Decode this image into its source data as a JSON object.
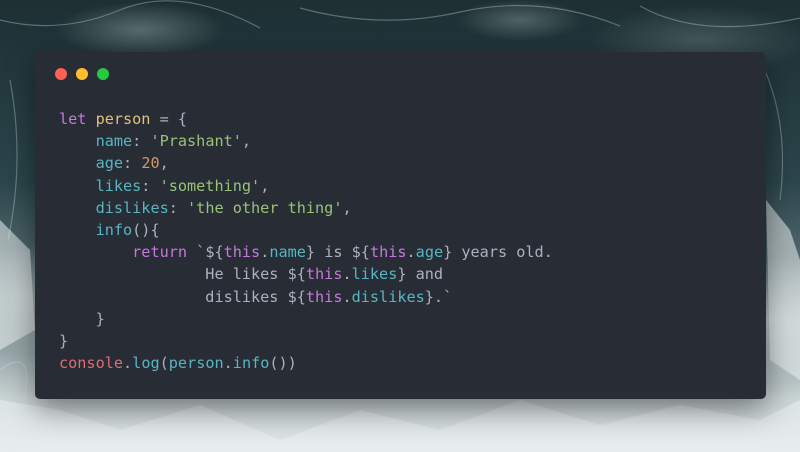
{
  "window": {
    "controls": [
      {
        "name": "close",
        "color": "#ff5f56"
      },
      {
        "name": "minimize",
        "color": "#ffbd2e"
      },
      {
        "name": "maximize",
        "color": "#27c93f"
      }
    ]
  },
  "theme": {
    "background": "#282c34",
    "keyword": "#c678dd",
    "variable": "#e5c07b",
    "property": "#56b6c2",
    "string": "#98c379",
    "number": "#d19a66",
    "console": "#e06c75",
    "plain": "#abb2bf"
  },
  "code": {
    "lines": [
      [
        {
          "t": "keyword",
          "v": "let"
        },
        {
          "t": "plain",
          "v": " "
        },
        {
          "t": "var",
          "v": "person"
        },
        {
          "t": "plain",
          "v": " = {"
        }
      ],
      [
        {
          "t": "plain",
          "v": "    "
        },
        {
          "t": "prop",
          "v": "name"
        },
        {
          "t": "plain",
          "v": ": "
        },
        {
          "t": "string",
          "v": "'Prashant'"
        },
        {
          "t": "plain",
          "v": ","
        }
      ],
      [
        {
          "t": "plain",
          "v": "    "
        },
        {
          "t": "prop",
          "v": "age"
        },
        {
          "t": "plain",
          "v": ": "
        },
        {
          "t": "number",
          "v": "20"
        },
        {
          "t": "plain",
          "v": ","
        }
      ],
      [
        {
          "t": "plain",
          "v": "    "
        },
        {
          "t": "prop",
          "v": "likes"
        },
        {
          "t": "plain",
          "v": ": "
        },
        {
          "t": "string",
          "v": "'something'"
        },
        {
          "t": "plain",
          "v": ","
        }
      ],
      [
        {
          "t": "plain",
          "v": "    "
        },
        {
          "t": "prop",
          "v": "dislikes"
        },
        {
          "t": "plain",
          "v": ": "
        },
        {
          "t": "string",
          "v": "'the other thing'"
        },
        {
          "t": "plain",
          "v": ","
        }
      ],
      [
        {
          "t": "plain",
          "v": "    "
        },
        {
          "t": "prop",
          "v": "info"
        },
        {
          "t": "plain",
          "v": "(){"
        }
      ],
      [
        {
          "t": "plain",
          "v": "        "
        },
        {
          "t": "keyword",
          "v": "return"
        },
        {
          "t": "plain",
          "v": " `${"
        },
        {
          "t": "keyword",
          "v": "this"
        },
        {
          "t": "plain",
          "v": "."
        },
        {
          "t": "prop",
          "v": "name"
        },
        {
          "t": "plain",
          "v": "} is ${"
        },
        {
          "t": "keyword",
          "v": "this"
        },
        {
          "t": "plain",
          "v": "."
        },
        {
          "t": "prop",
          "v": "age"
        },
        {
          "t": "plain",
          "v": "} years old."
        }
      ],
      [
        {
          "t": "plain",
          "v": "                He likes ${"
        },
        {
          "t": "keyword",
          "v": "this"
        },
        {
          "t": "plain",
          "v": "."
        },
        {
          "t": "prop",
          "v": "likes"
        },
        {
          "t": "plain",
          "v": "} and"
        }
      ],
      [
        {
          "t": "plain",
          "v": "                dislikes ${"
        },
        {
          "t": "keyword",
          "v": "this"
        },
        {
          "t": "plain",
          "v": "."
        },
        {
          "t": "prop",
          "v": "dislikes"
        },
        {
          "t": "plain",
          "v": "}.`"
        }
      ],
      [
        {
          "t": "plain",
          "v": "    }"
        }
      ],
      [
        {
          "t": "plain",
          "v": "}"
        }
      ],
      [
        {
          "t": "console",
          "v": "console"
        },
        {
          "t": "plain",
          "v": "."
        },
        {
          "t": "prop",
          "v": "log"
        },
        {
          "t": "plain",
          "v": "("
        },
        {
          "t": "prop",
          "v": "person"
        },
        {
          "t": "plain",
          "v": "."
        },
        {
          "t": "prop",
          "v": "info"
        },
        {
          "t": "plain",
          "v": "())"
        }
      ]
    ]
  }
}
